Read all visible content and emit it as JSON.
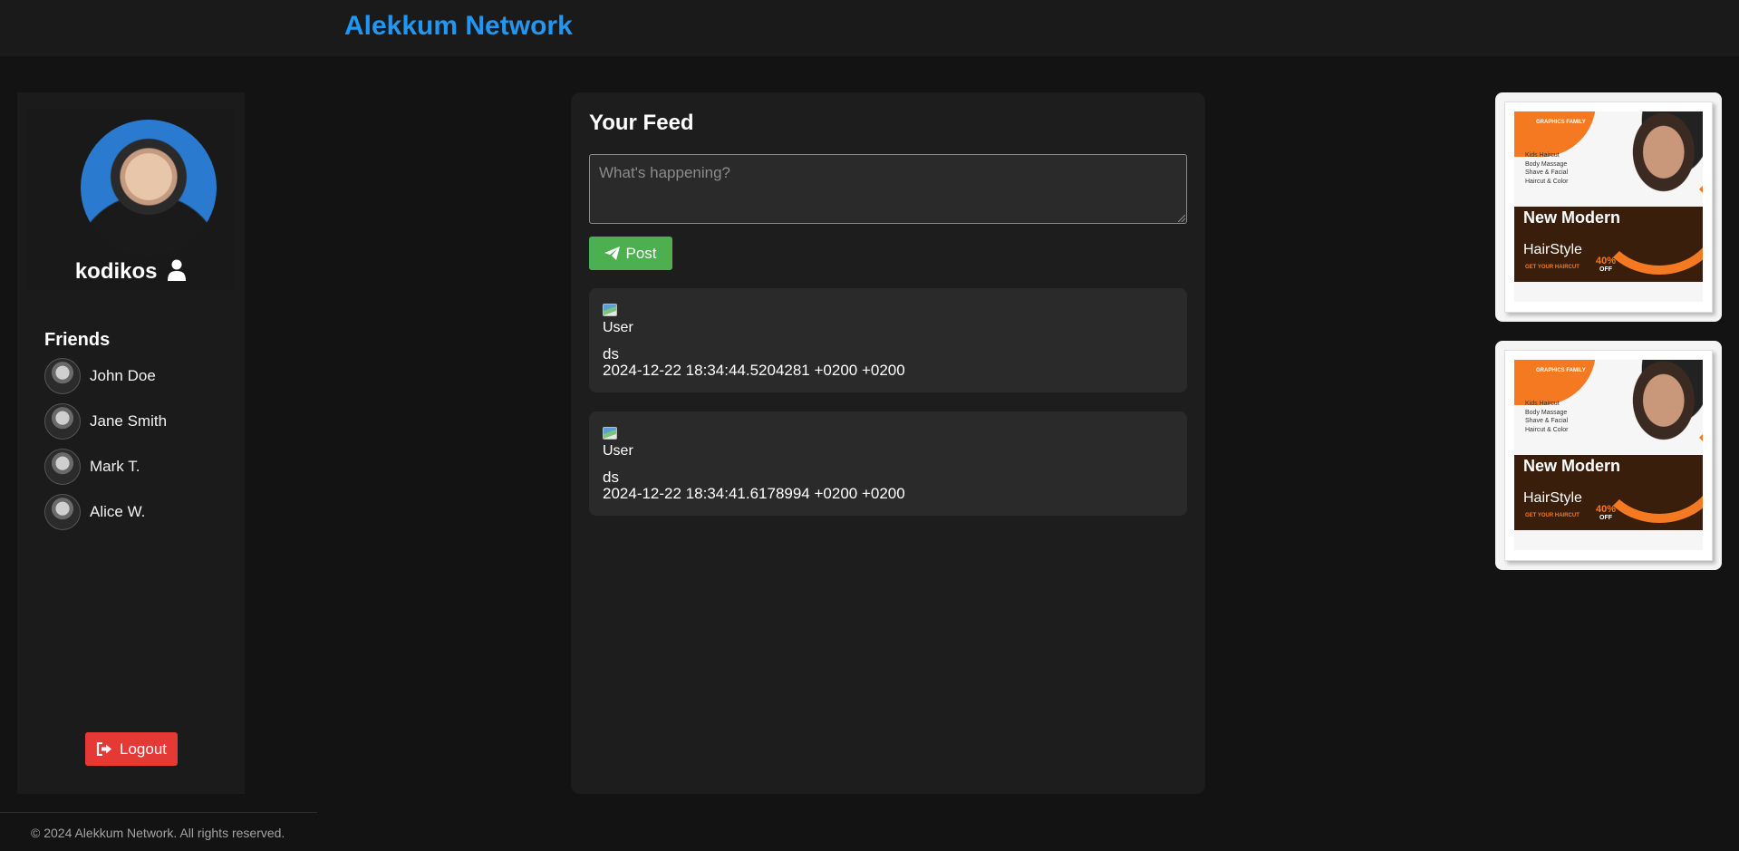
{
  "header": {
    "brand": "Alekkum Network"
  },
  "profile": {
    "username": "kodikos"
  },
  "friends": {
    "title": "Friends",
    "items": [
      {
        "name": "John Doe"
      },
      {
        "name": "Jane Smith"
      },
      {
        "name": "Mark T."
      },
      {
        "name": "Alice W."
      }
    ]
  },
  "logout": {
    "label": "Logout"
  },
  "footer": {
    "text": "© 2024 Alekkum Network. All rights reserved."
  },
  "feed": {
    "title": "Your Feed",
    "composer_placeholder": "What's happening?",
    "post_label": "Post",
    "posts": [
      {
        "avatar_alt": "User",
        "content": "ds",
        "timestamp": "2024-12-22 18:34:44.5204281 +0200 +0200"
      },
      {
        "avatar_alt": "User",
        "content": "ds",
        "timestamp": "2024-12-22 18:34:41.6178994 +0200 +0200"
      }
    ]
  },
  "ads": [
    {
      "brand": "GRAPHICS FAMILY",
      "services": [
        "Kids Haircut",
        "Body Massage",
        "Shave & Facial",
        "Haircut & Color"
      ],
      "headline_1": "New Modern",
      "headline_2": "HairStyle",
      "cta": "GET YOUR HAIRCUT",
      "discount": "40%",
      "discount_suffix": "OFF"
    },
    {
      "brand": "GRAPHICS FAMILY",
      "services": [
        "Kids Haircut",
        "Body Massage",
        "Shave & Facial",
        "Haircut & Color"
      ],
      "headline_1": "New Modern",
      "headline_2": "HairStyle",
      "cta": "GET YOUR HAIRCUT",
      "discount": "40%",
      "discount_suffix": "OFF"
    }
  ],
  "colors": {
    "brand": "#2196f3",
    "post_button": "#4caf50",
    "logout_button": "#e53935",
    "ad_accent": "#f47920"
  }
}
